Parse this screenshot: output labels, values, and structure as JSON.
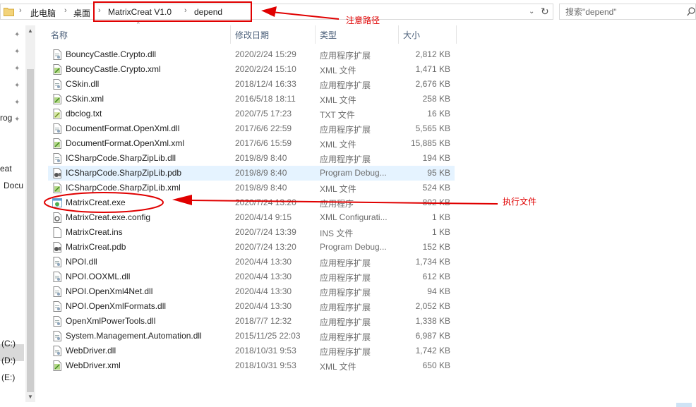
{
  "address_bar": {
    "crumbs": [
      "此电脑",
      "桌面",
      "MatrixCreat V1.0",
      "depend"
    ],
    "dropdown_icon": "chevron-down-icon",
    "refresh_icon": "refresh-icon"
  },
  "search": {
    "placeholder": "搜索\"depend\"",
    "icon": "search-icon"
  },
  "columns": {
    "name": "名称",
    "date": "修改日期",
    "type": "类型",
    "size": "大小"
  },
  "nav": {
    "items": [
      "rog",
      "eat",
      "Docu",
      "(C:)",
      "(D:)",
      "(E:)"
    ]
  },
  "files": [
    {
      "name": "BouncyCastle.Crypto.dll",
      "date": "2020/2/24 15:29",
      "type": "应用程序扩展",
      "size": "2,812 KB",
      "icon": "dll"
    },
    {
      "name": "BouncyCastle.Crypto.xml",
      "date": "2020/2/24 15:10",
      "type": "XML 文件",
      "size": "1,471 KB",
      "icon": "xml"
    },
    {
      "name": "CSkin.dll",
      "date": "2018/12/4 16:33",
      "type": "应用程序扩展",
      "size": "2,676 KB",
      "icon": "dll"
    },
    {
      "name": "CSkin.xml",
      "date": "2016/5/18 18:11",
      "type": "XML 文件",
      "size": "258 KB",
      "icon": "xml"
    },
    {
      "name": "dbclog.txt",
      "date": "2020/7/5 17:23",
      "type": "TXT 文件",
      "size": "16 KB",
      "icon": "txt"
    },
    {
      "name": "DocumentFormat.OpenXml.dll",
      "date": "2017/6/6 22:59",
      "type": "应用程序扩展",
      "size": "5,565 KB",
      "icon": "dll"
    },
    {
      "name": "DocumentFormat.OpenXml.xml",
      "date": "2017/6/6 15:59",
      "type": "XML 文件",
      "size": "15,885 KB",
      "icon": "xml"
    },
    {
      "name": "ICSharpCode.SharpZipLib.dll",
      "date": "2019/8/9 8:40",
      "type": "应用程序扩展",
      "size": "194 KB",
      "icon": "dll"
    },
    {
      "name": "ICSharpCode.SharpZipLib.pdb",
      "date": "2019/8/9 8:40",
      "type": "Program Debug...",
      "size": "95 KB",
      "icon": "pdb"
    },
    {
      "name": "ICSharpCode.SharpZipLib.xml",
      "date": "2019/8/9 8:40",
      "type": "XML 文件",
      "size": "524 KB",
      "icon": "xml"
    },
    {
      "name": "MatrixCreat.exe",
      "date": "2020/7/24 13:20",
      "type": "应用程序",
      "size": "802 KB",
      "icon": "exe"
    },
    {
      "name": "MatrixCreat.exe.config",
      "date": "2020/4/14 9:15",
      "type": "XML Configurati...",
      "size": "1 KB",
      "icon": "config"
    },
    {
      "name": "MatrixCreat.ins",
      "date": "2020/7/24 13:39",
      "type": "INS 文件",
      "size": "1 KB",
      "icon": "blank"
    },
    {
      "name": "MatrixCreat.pdb",
      "date": "2020/7/24 13:20",
      "type": "Program Debug...",
      "size": "152 KB",
      "icon": "pdb"
    },
    {
      "name": "NPOI.dll",
      "date": "2020/4/4 13:30",
      "type": "应用程序扩展",
      "size": "1,734 KB",
      "icon": "dll"
    },
    {
      "name": "NPOI.OOXML.dll",
      "date": "2020/4/4 13:30",
      "type": "应用程序扩展",
      "size": "612 KB",
      "icon": "dll"
    },
    {
      "name": "NPOI.OpenXml4Net.dll",
      "date": "2020/4/4 13:30",
      "type": "应用程序扩展",
      "size": "94 KB",
      "icon": "dll"
    },
    {
      "name": "NPOI.OpenXmlFormats.dll",
      "date": "2020/4/4 13:30",
      "type": "应用程序扩展",
      "size": "2,052 KB",
      "icon": "dll"
    },
    {
      "name": "OpenXmlPowerTools.dll",
      "date": "2018/7/7 12:32",
      "type": "应用程序扩展",
      "size": "1,338 KB",
      "icon": "dll"
    },
    {
      "name": "System.Management.Automation.dll",
      "date": "2015/11/25 22:03",
      "type": "应用程序扩展",
      "size": "6,987 KB",
      "icon": "dll"
    },
    {
      "name": "WebDriver.dll",
      "date": "2018/10/31 9:53",
      "type": "应用程序扩展",
      "size": "1,742 KB",
      "icon": "dll"
    },
    {
      "name": "WebDriver.xml",
      "date": "2018/10/31 9:53",
      "type": "XML 文件",
      "size": "650 KB",
      "icon": "xml"
    }
  ],
  "annotations": {
    "path_note": "注意路径",
    "exe_note": "执行文件",
    "color": "#e00000"
  },
  "hover_color": "#e5f3ff"
}
